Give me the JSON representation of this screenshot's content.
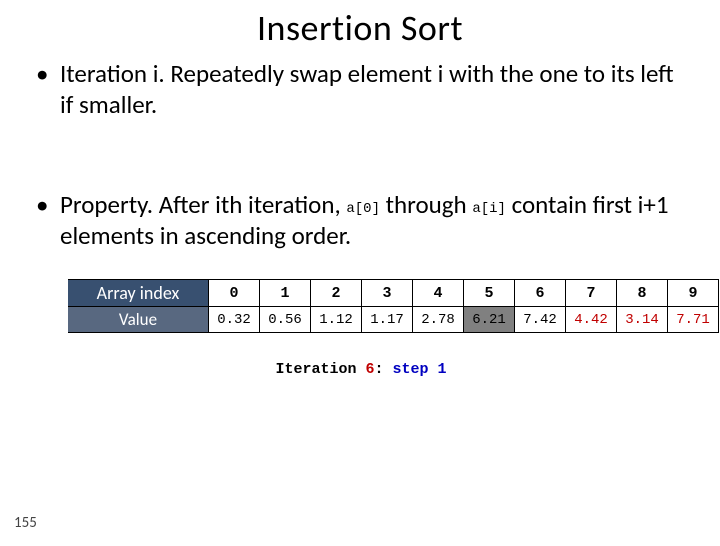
{
  "title": "Insertion Sort",
  "bullets": {
    "b1": "Iteration i.  Repeatedly swap element i with the one to its left if smaller.",
    "b2_pre": "Property.  After ith iteration, ",
    "b2_code1": "a[0]",
    "b2_mid": " through ",
    "b2_code2": "a[i]",
    "b2_post": " contain first i+1 elements in ascending order."
  },
  "table": {
    "row1_label": "Array index",
    "row2_label": "Value",
    "indices": [
      "0",
      "1",
      "2",
      "3",
      "4",
      "5",
      "6",
      "7",
      "8",
      "9"
    ],
    "values": [
      "0.32",
      "0.56",
      "1.12",
      "1.17",
      "2.78",
      "6.21",
      "7.42",
      "4.42",
      "3.14",
      "7.71"
    ],
    "highlight_index": 5,
    "red_after_index": 6
  },
  "caption": {
    "iter_word": "Iteration ",
    "iter_num": "6",
    "sep": ": ",
    "step": "step 1"
  },
  "page": "155"
}
